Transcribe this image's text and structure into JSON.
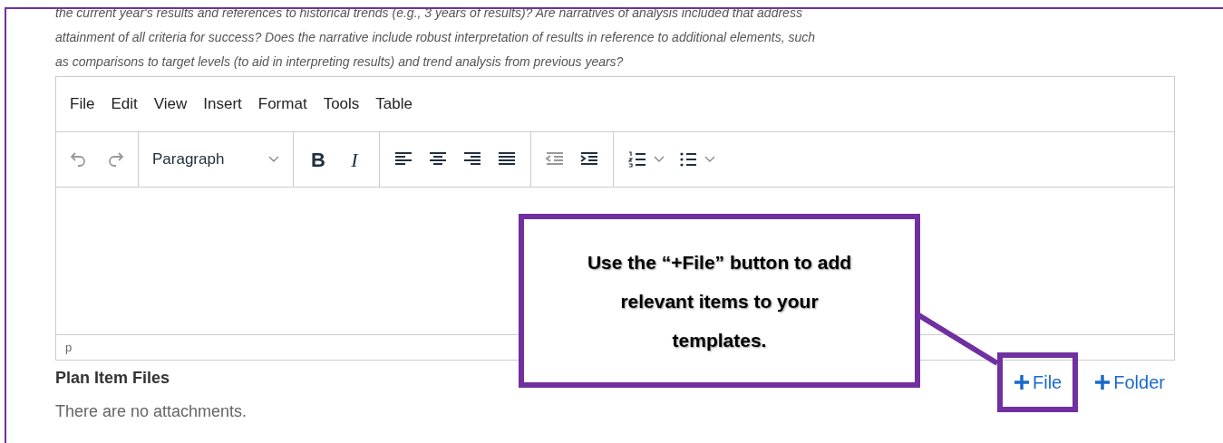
{
  "question_lines": [
    "the current year's results and references to historical trends (e.g., 3 years of results)? Are narratives of analysis included that address",
    "attainment of all criteria for success? Does the narrative include robust interpretation of results in reference to additional elements, such",
    "as comparisons to target levels (to aid in interpreting results) and trend analysis from previous years?"
  ],
  "editor": {
    "menu": [
      "File",
      "Edit",
      "View",
      "Insert",
      "Format",
      "Tools",
      "Table"
    ],
    "toolbar": [
      [
        {
          "kind": "undo",
          "disabled": true
        },
        {
          "kind": "redo",
          "disabled": true
        }
      ],
      [
        {
          "kind": "select",
          "label": "Paragraph"
        }
      ],
      [
        {
          "kind": "bold",
          "label": "B"
        },
        {
          "kind": "italic",
          "label": "I"
        }
      ],
      [
        {
          "kind": "align-left"
        },
        {
          "kind": "align-center"
        },
        {
          "kind": "align-right"
        },
        {
          "kind": "justify"
        }
      ],
      [
        {
          "kind": "outdent",
          "disabled": true
        },
        {
          "kind": "indent",
          "disabled": false
        }
      ],
      [
        {
          "kind": "numbered-list"
        },
        {
          "kind": "bullet-list"
        }
      ]
    ],
    "status_path": "p"
  },
  "attachments": {
    "heading": "Plan Item Files",
    "empty_text": "There are no attachments.",
    "buttons": [
      {
        "label": "File",
        "highlighted": true
      },
      {
        "label": "Folder",
        "highlighted": false
      }
    ]
  },
  "callout": {
    "text": "Use the “+File” button to add relevant items to your templates."
  }
}
